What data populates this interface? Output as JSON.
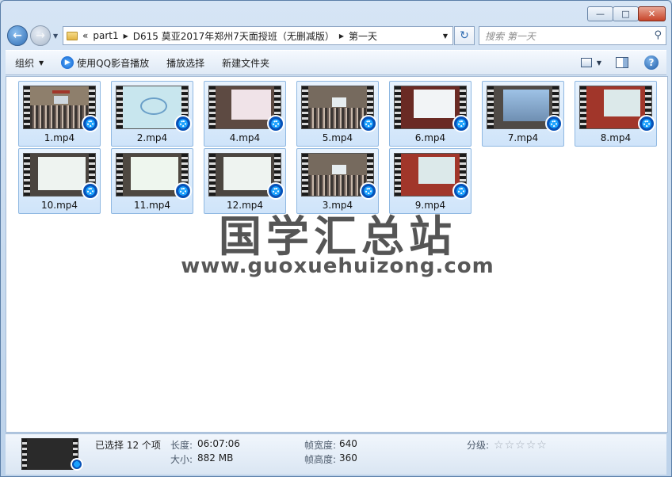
{
  "window": {
    "caption_buttons": [
      "—",
      "□",
      "✕"
    ]
  },
  "nav": {
    "address": {
      "overflow": "«",
      "crumbs": [
        "part1",
        "D615 莫亚2017年郑州7天面授班（无删减版）",
        "第一天"
      ]
    },
    "search_placeholder": "搜索 第一天"
  },
  "toolbar": {
    "organize": "组织",
    "qq_play": "使用QQ影音播放",
    "play_selection": "播放选择",
    "new_folder": "新建文件夹"
  },
  "files": [
    {
      "name": "1.mp4",
      "scene": "hall"
    },
    {
      "name": "2.mp4",
      "scene": "diagram"
    },
    {
      "name": "4.mp4",
      "scene": "screen-pink"
    },
    {
      "name": "5.mp4",
      "scene": "hall-small"
    },
    {
      "name": "6.mp4",
      "scene": "screen-text"
    },
    {
      "name": "7.mp4",
      "scene": "sky"
    },
    {
      "name": "8.mp4",
      "scene": "screen-red"
    },
    {
      "name": "10.mp4",
      "scene": "whiteboard"
    },
    {
      "name": "11.mp4",
      "scene": "whiteboard-green"
    },
    {
      "name": "12.mp4",
      "scene": "whiteboard"
    },
    {
      "name": "3.mp4",
      "scene": "hall-small"
    },
    {
      "name": "9.mp4",
      "scene": "screen-red"
    }
  ],
  "watermark": {
    "title": "国学汇总站",
    "url": "www.guoxuehuizong.com"
  },
  "details": {
    "selected": "已选择 12 个项",
    "length_label": "长度:",
    "length": "06:07:06",
    "size_label": "大小:",
    "size": "882 MB",
    "frame_width_label": "帧宽度:",
    "frame_width": "640",
    "frame_height_label": "帧高度:",
    "frame_height": "360",
    "rating_label": "分级:",
    "rating": 0,
    "rating_max": 5
  },
  "colors": {
    "accent": "#3a7bd5",
    "selection": "#cfe4fa",
    "wall_red": "#a1362a"
  }
}
